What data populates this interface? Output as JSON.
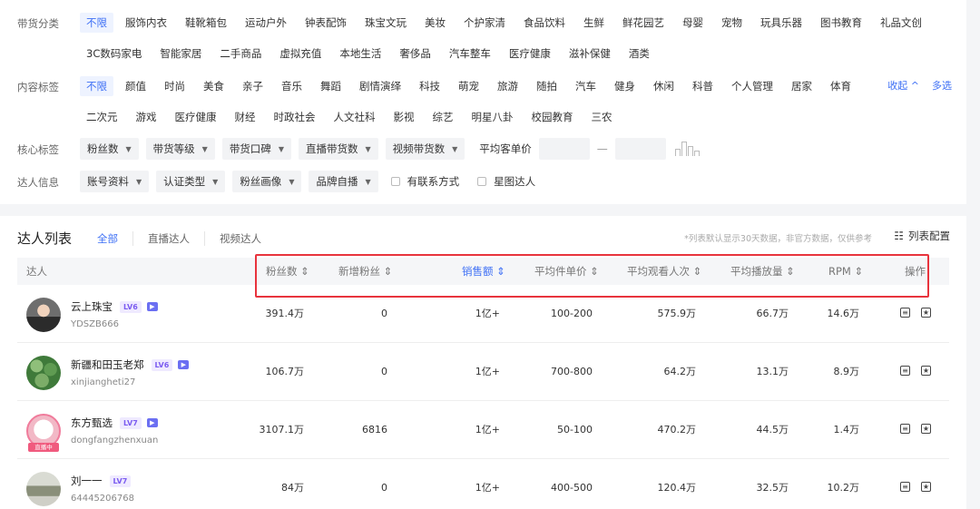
{
  "filters": {
    "category_label": "带货分类",
    "categories": [
      "不限",
      "服饰内衣",
      "鞋靴箱包",
      "运动户外",
      "钟表配饰",
      "珠宝文玩",
      "美妆",
      "个护家清",
      "食品饮料",
      "生鲜",
      "鲜花园艺",
      "母婴",
      "宠物",
      "玩具乐器",
      "图书教育",
      "礼品文创",
      "3C数码家电",
      "智能家居",
      "二手商品",
      "虚拟充值",
      "本地生活",
      "奢侈品",
      "汽车整车",
      "医疗健康",
      "滋补保健",
      "酒类"
    ],
    "tag_label": "内容标签",
    "tags": [
      "不限",
      "颜值",
      "时尚",
      "美食",
      "亲子",
      "音乐",
      "舞蹈",
      "剧情演绎",
      "科技",
      "萌宠",
      "旅游",
      "随拍",
      "汽车",
      "健身",
      "休闲",
      "科普",
      "个人管理",
      "居家",
      "体育",
      "二次元",
      "游戏",
      "医疗健康",
      "财经",
      "时政社会",
      "人文社科",
      "影视",
      "综艺",
      "明星八卦",
      "校园教育",
      "三农"
    ],
    "collapse_label": "收起 ^",
    "multi_label": "多选",
    "core_label": "核心标签",
    "core_dropdowns": [
      "粉丝数",
      "带货等级",
      "带货口碑",
      "直播带货数",
      "视频带货数"
    ],
    "avg_price_label": "平均客单价",
    "dash": "—",
    "talent_label": "达人信息",
    "talent_dropdowns": [
      "账号资料",
      "认证类型",
      "粉丝画像",
      "品牌自播"
    ],
    "checkboxes": [
      "有联系方式",
      "星图达人"
    ]
  },
  "list": {
    "title": "达人列表",
    "tabs": [
      "全部",
      "直播达人",
      "视频达人"
    ],
    "note": "*列表默认显示30天数据，非官方数据，仅供参考",
    "config_label": "列表配置",
    "columns": [
      "达人",
      "粉丝数",
      "新增粉丝",
      "销售额",
      "平均件单价",
      "平均观看人次",
      "平均播放量",
      "RPM",
      "操作"
    ],
    "rows": [
      {
        "name": "云上珠宝",
        "level": "LV6",
        "handle": "YDSZB666",
        "fans": "391.4万",
        "new_fans": "0",
        "sales": "1亿+",
        "unit_price": "100-200",
        "avg_views": "575.9万",
        "avg_plays": "66.7万",
        "rpm": "14.6万"
      },
      {
        "name": "新疆和田玉老郑",
        "level": "LV6",
        "handle": "xinjiangheti27",
        "fans": "106.7万",
        "new_fans": "0",
        "sales": "1亿+",
        "unit_price": "700-800",
        "avg_views": "64.2万",
        "avg_plays": "13.1万",
        "rpm": "8.9万"
      },
      {
        "name": "东方甄选",
        "level": "LV7",
        "handle": "dongfangzhenxuan",
        "fans": "3107.1万",
        "new_fans": "6816",
        "sales": "1亿+",
        "unit_price": "50-100",
        "avg_views": "470.2万",
        "avg_plays": "44.5万",
        "rpm": "1.4万",
        "live_badge": "直播中"
      },
      {
        "name": "刘一一",
        "level": "LV7",
        "handle": "64445206768",
        "fans": "84万",
        "new_fans": "0",
        "sales": "1亿+",
        "unit_price": "400-500",
        "avg_views": "120.4万",
        "avg_plays": "32.5万",
        "rpm": "10.2万"
      }
    ]
  },
  "colors": {
    "accent": "#3d6ff5",
    "highlight_border": "#e8333d",
    "level_badge": "#7b5cf0"
  }
}
